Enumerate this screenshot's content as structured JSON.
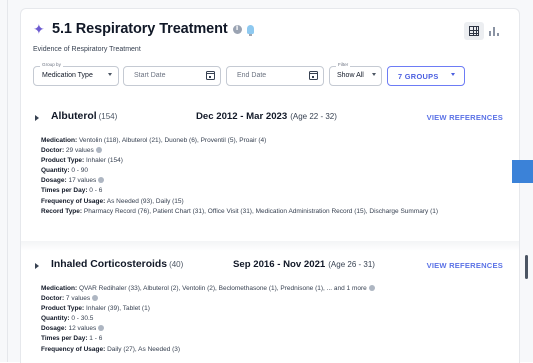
{
  "header": {
    "title": "5.1 Respiratory Treatment",
    "subtitle": "Evidence of Respiratory Treatment",
    "icons": [
      "sparkle-icon",
      "info-icon",
      "lightbulb-icon",
      "table-view-icon",
      "bar-chart-icon"
    ]
  },
  "filters": {
    "group_by_label": "Group by",
    "group_by_value": "Medication Type",
    "start_date_placeholder": "Start Date",
    "end_date_placeholder": "End Date",
    "filter_label": "Filter",
    "filter_value": "Show All",
    "groups_button": "7 GROUPS"
  },
  "sections": [
    {
      "name": "Albuterol",
      "count": "(154)",
      "range": "Dec 2012 - Mar 2023",
      "age": "(Age 22 - 32)",
      "view_refs": "VIEW REFERENCES",
      "rows": [
        {
          "label": "Medication:",
          "value": "Ventolin (118),  Albuterol (21),  Duoneb (6),  Proventil (5),  Proair (4)",
          "info": false
        },
        {
          "label": "Doctor:",
          "value": "29 values",
          "info": true
        },
        {
          "label": "Product Type:",
          "value": "Inhaler (154)",
          "info": false
        },
        {
          "label": "Quantity:",
          "value": "0 - 90",
          "info": false
        },
        {
          "label": "Dosage:",
          "value": "17 values",
          "info": true
        },
        {
          "label": "Times per Day:",
          "value": "0 - 6",
          "info": false
        },
        {
          "label": "Frequency of Usage:",
          "value": "As Needed (93),  Daily (15)",
          "info": false
        },
        {
          "label": "Record Type:",
          "value": "Pharmacy Record (76),  Patient Chart (31),  Office Visit (31),  Medication Administration Record (15),  Discharge Summary (1)",
          "info": false
        }
      ]
    },
    {
      "name": "Inhaled Corticosteroids",
      "count": "(40)",
      "range": "Sep 2016 - Nov 2021",
      "age": "(Age 26 - 31)",
      "view_refs": "VIEW REFERENCES",
      "rows": [
        {
          "label": "Medication:",
          "value": "QVAR Redihaler (33),  Albuterol (2),  Ventolin (2),  Beclomethasone (1),  Prednisone (1),  ... and 1 more",
          "info": true
        },
        {
          "label": "Doctor:",
          "value": "7 values",
          "info": true
        },
        {
          "label": "Product Type:",
          "value": "Inhaler (39),  Tablet (1)",
          "info": false
        },
        {
          "label": "Quantity:",
          "value": "0 - 30.5",
          "info": false
        },
        {
          "label": "Dosage:",
          "value": "12 values",
          "info": true
        },
        {
          "label": "Times per Day:",
          "value": "1 - 6",
          "info": false
        },
        {
          "label": "Frequency of Usage:",
          "value": "Daily (27),  As Needed (3)",
          "info": false
        }
      ]
    }
  ],
  "colors": {
    "accent": "#5b72e6",
    "sparkle": "#6d5bd0",
    "side_tab": "#3b82d8"
  }
}
